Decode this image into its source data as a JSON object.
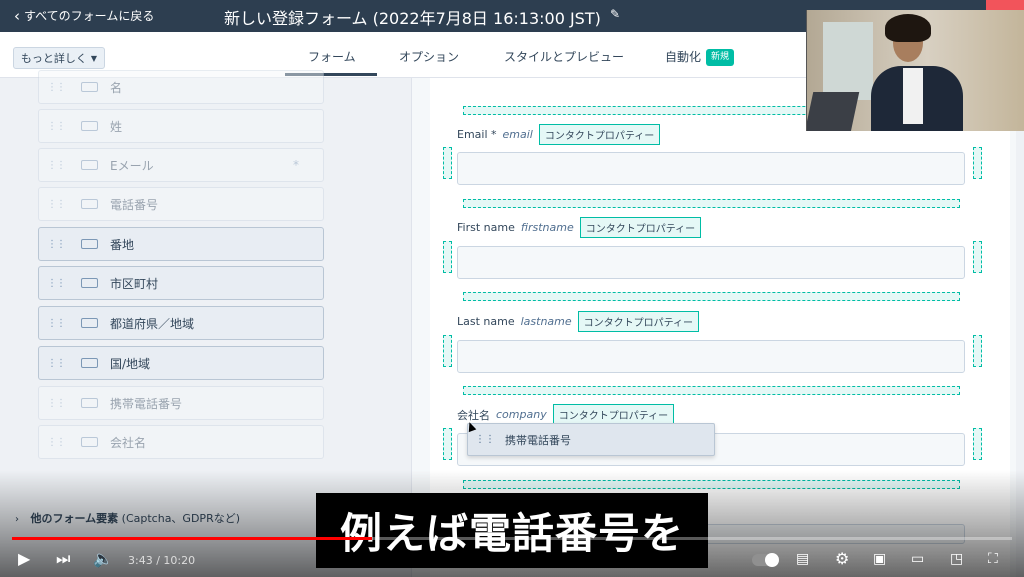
{
  "topbar": {
    "back_label": "すべてのフォームに戻る",
    "title": "新しい登録フォーム (2022年7月8日 16:13:00 JST)"
  },
  "tabs": {
    "more_label": "もっと詳しく",
    "items": [
      {
        "label": "フォーム",
        "active": true
      },
      {
        "label": "オプション",
        "active": false
      },
      {
        "label": "スタイルとプレビュー",
        "active": false
      },
      {
        "label": "自動化",
        "active": false
      }
    ],
    "new_badge": "新規"
  },
  "left_panel": {
    "fields": [
      {
        "label": "名",
        "state": "used"
      },
      {
        "label": "姓",
        "state": "used"
      },
      {
        "label": "Eメール",
        "state": "used",
        "required_mark": "*"
      },
      {
        "label": "電話番号",
        "state": "used"
      },
      {
        "label": "番地",
        "state": "available"
      },
      {
        "label": "市区町村",
        "state": "available"
      },
      {
        "label": "都道府県／地域",
        "state": "available"
      },
      {
        "label": "国/地域",
        "state": "available"
      },
      {
        "label": "携帯電話番号",
        "state": "used"
      },
      {
        "label": "会社名",
        "state": "used"
      }
    ],
    "other_elements_bold": "他のフォーム要素",
    "other_elements_rest": " (Captcha、GDPRなど)"
  },
  "form_canvas": {
    "fields": [
      {
        "label": "Email *",
        "internal": "email",
        "badge": "コンタクトプロパティー"
      },
      {
        "label": "First name",
        "internal": "firstname",
        "badge": "コンタクトプロパティー"
      },
      {
        "label": "Last name",
        "internal": "lastname",
        "badge": "コンタクトプロパティー"
      },
      {
        "label": "会社名",
        "internal": "company",
        "badge": "コンタクトプロパティー"
      }
    ],
    "drag_ghost_label": "携帯電話番号"
  },
  "video": {
    "subtitle": "例えば電話番号を",
    "time": "3:43 / 10:20",
    "progress": 0.36
  },
  "colors": {
    "topbar": "#2d3e50",
    "accent_teal": "#00bda5",
    "progress_red": "#ff0000"
  }
}
